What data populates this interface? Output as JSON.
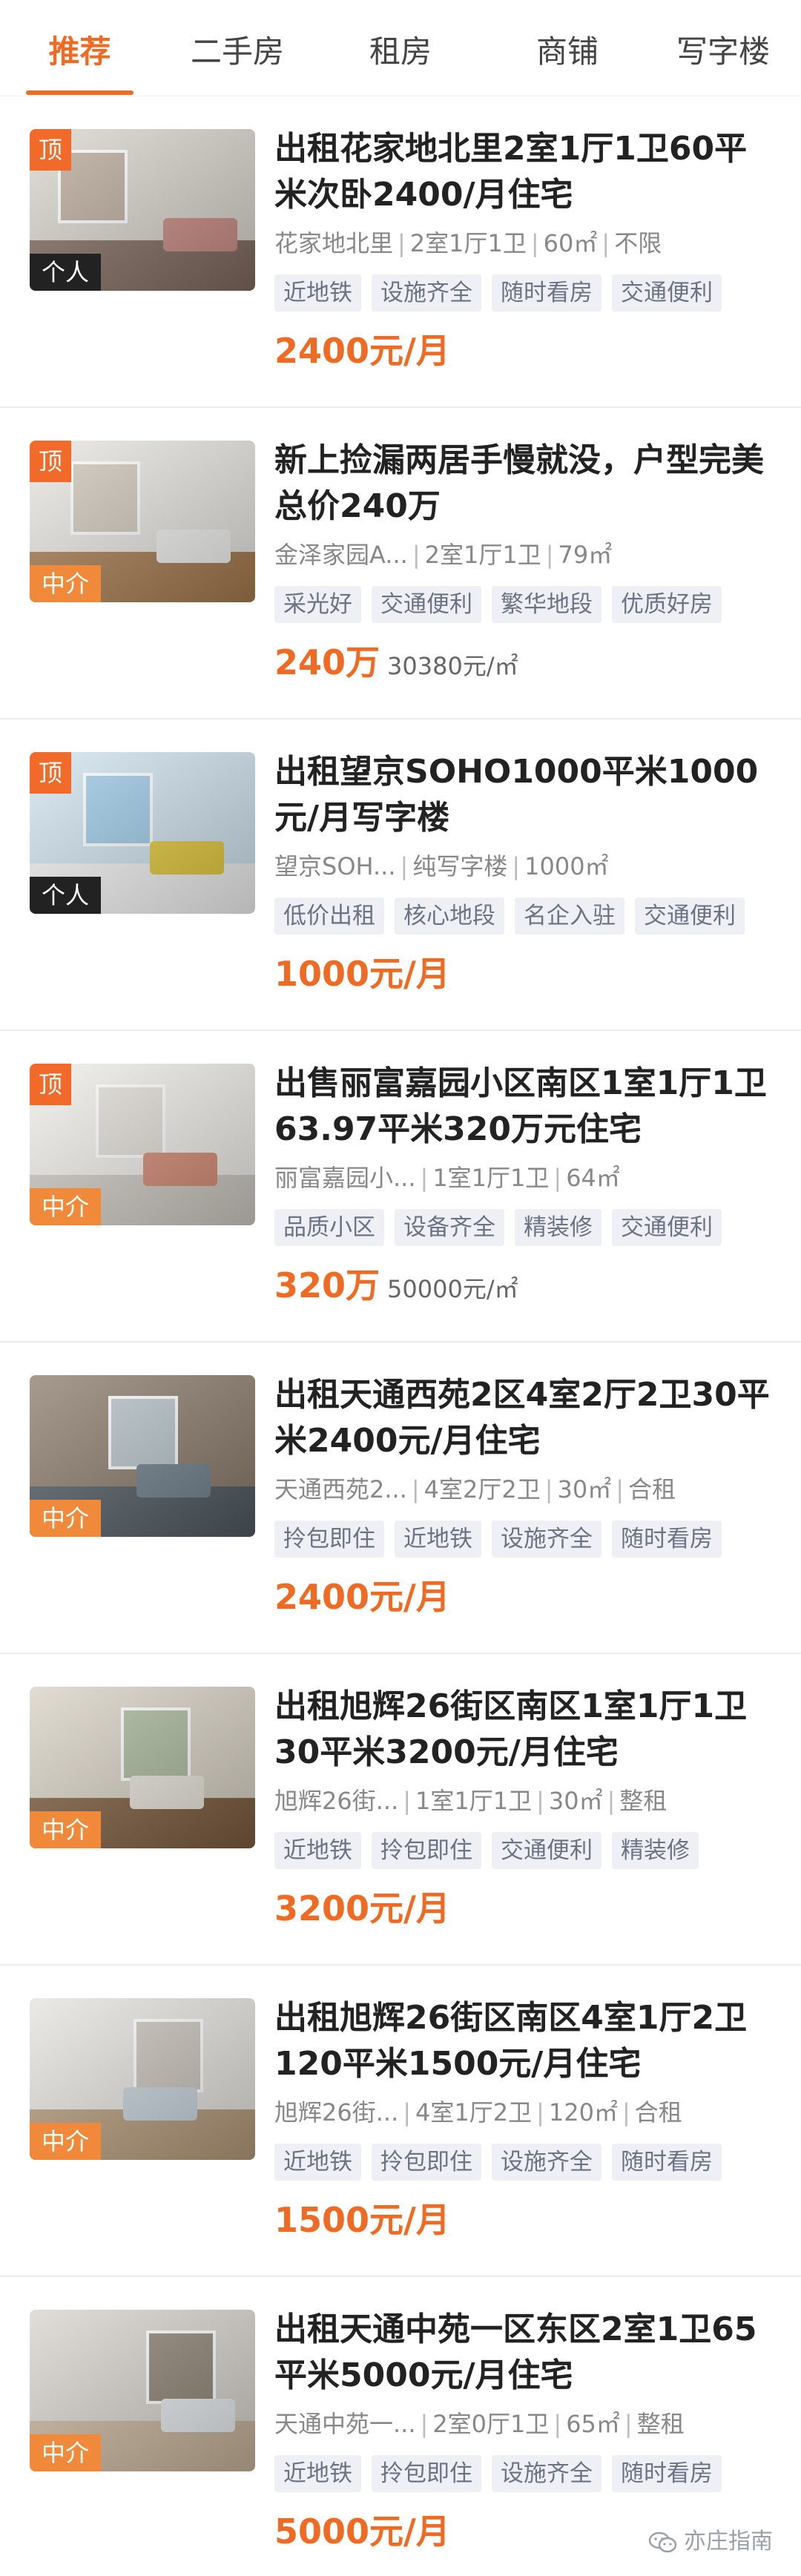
{
  "tabs": [
    {
      "label": "推荐",
      "active": true
    },
    {
      "label": "二手房",
      "active": false
    },
    {
      "label": "租房",
      "active": false
    },
    {
      "label": "商铺",
      "active": false
    },
    {
      "label": "写字楼",
      "active": false
    }
  ],
  "colors": {
    "accent": "#ef6b24",
    "tag_bg": "#eef0f5",
    "tag_text": "#6b7384"
  },
  "listings": [
    {
      "title": "出租花家地北里2室1厅1卫60平米次卧2400/月住宅",
      "top_badge": "顶",
      "agent": "个人",
      "agent_type": "geren",
      "meta": [
        "花家地北里",
        "2室1厅1卫",
        "60㎡",
        "不限"
      ],
      "tags": [
        "近地铁",
        "设施齐全",
        "随时看房",
        "交通便利"
      ],
      "price": "2400元/月",
      "unit_price": ""
    },
    {
      "title": "新上捡漏两居手慢就没，户型完美总价240万",
      "top_badge": "顶",
      "agent": "中介",
      "agent_type": "zhongjie",
      "meta": [
        "金泽家园A...",
        "2室1厅1卫",
        "79㎡"
      ],
      "tags": [
        "采光好",
        "交通便利",
        "繁华地段",
        "优质好房"
      ],
      "price": "240万",
      "unit_price": "30380元/㎡"
    },
    {
      "title": "出租望京SOHO1000平米1000元/月写字楼",
      "top_badge": "顶",
      "agent": "个人",
      "agent_type": "geren",
      "meta": [
        "望京SOH...",
        "纯写字楼",
        "1000㎡"
      ],
      "tags": [
        "低价出租",
        "核心地段",
        "名企入驻",
        "交通便利"
      ],
      "price": "1000元/月",
      "unit_price": ""
    },
    {
      "title": "出售丽富嘉园小区南区1室1厅1卫63.97平米320万元住宅",
      "top_badge": "顶",
      "agent": "中介",
      "agent_type": "zhongjie",
      "meta": [
        "丽富嘉园小...",
        "1室1厅1卫",
        "64㎡"
      ],
      "tags": [
        "品质小区",
        "设备齐全",
        "精装修",
        "交通便利"
      ],
      "price": "320万",
      "unit_price": "50000元/㎡"
    },
    {
      "title": "出租天通西苑2区4室2厅2卫30平米2400元/月住宅",
      "top_badge": "",
      "agent": "中介",
      "agent_type": "zhongjie",
      "meta": [
        "天通西苑2...",
        "4室2厅2卫",
        "30㎡",
        "合租"
      ],
      "tags": [
        "拎包即住",
        "近地铁",
        "设施齐全",
        "随时看房"
      ],
      "price": "2400元/月",
      "unit_price": ""
    },
    {
      "title": "出租旭辉26街区南区1室1厅1卫30平米3200元/月住宅",
      "top_badge": "",
      "agent": "中介",
      "agent_type": "zhongjie",
      "meta": [
        "旭辉26街...",
        "1室1厅1卫",
        "30㎡",
        "整租"
      ],
      "tags": [
        "近地铁",
        "拎包即住",
        "交通便利",
        "精装修"
      ],
      "price": "3200元/月",
      "unit_price": ""
    },
    {
      "title": "出租旭辉26街区南区4室1厅2卫120平米1500元/月住宅",
      "top_badge": "",
      "agent": "中介",
      "agent_type": "zhongjie",
      "meta": [
        "旭辉26街...",
        "4室1厅2卫",
        "120㎡",
        "合租"
      ],
      "tags": [
        "近地铁",
        "拎包即住",
        "设施齐全",
        "随时看房"
      ],
      "price": "1500元/月",
      "unit_price": ""
    },
    {
      "title": "出租天通中苑一区东区2室1卫65平米5000元/月住宅",
      "top_badge": "",
      "agent": "中介",
      "agent_type": "zhongjie",
      "meta": [
        "天通中苑一...",
        "2室0厅1卫",
        "65㎡",
        "整租"
      ],
      "tags": [
        "近地铁",
        "拎包即住",
        "设施齐全",
        "随时看房"
      ],
      "price": "5000元/月",
      "unit_price": ""
    }
  ],
  "watermark": {
    "text": "亦庄指南",
    "icon": "wechat-icon"
  }
}
